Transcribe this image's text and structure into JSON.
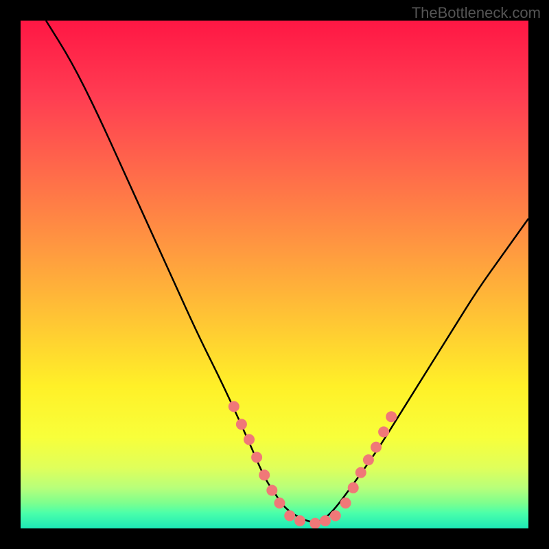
{
  "watermark": "TheBottleneck.com",
  "chart_data": {
    "type": "line",
    "title": "",
    "xlabel": "",
    "ylabel": "",
    "xlim": [
      0,
      100
    ],
    "ylim": [
      0,
      100
    ],
    "curve": {
      "x": [
        5,
        10,
        15,
        20,
        25,
        30,
        35,
        40,
        45,
        48,
        50,
        52,
        55,
        58,
        60,
        62,
        65,
        70,
        75,
        80,
        85,
        90,
        95,
        100
      ],
      "y": [
        100,
        92,
        82,
        71,
        60,
        49,
        38,
        28,
        17,
        10,
        7,
        4,
        2,
        1,
        2,
        4,
        8,
        15,
        23,
        31,
        39,
        47,
        54,
        61
      ]
    },
    "dots": {
      "color": "#f07878",
      "radius": 8,
      "left_cluster": [
        {
          "x": 42,
          "y": 24
        },
        {
          "x": 43.5,
          "y": 20.5
        },
        {
          "x": 45,
          "y": 17.5
        },
        {
          "x": 46.5,
          "y": 14
        },
        {
          "x": 48,
          "y": 10.5
        },
        {
          "x": 49.5,
          "y": 7.5
        },
        {
          "x": 51,
          "y": 5
        }
      ],
      "bottom_cluster": [
        {
          "x": 53,
          "y": 2.5
        },
        {
          "x": 55,
          "y": 1.5
        },
        {
          "x": 58,
          "y": 1
        },
        {
          "x": 60,
          "y": 1.5
        },
        {
          "x": 62,
          "y": 2.5
        }
      ],
      "right_cluster": [
        {
          "x": 64,
          "y": 5
        },
        {
          "x": 65.5,
          "y": 8
        },
        {
          "x": 67,
          "y": 11
        },
        {
          "x": 68.5,
          "y": 13.5
        },
        {
          "x": 70,
          "y": 16
        },
        {
          "x": 71.5,
          "y": 19
        },
        {
          "x": 73,
          "y": 22
        }
      ]
    },
    "gradient_stops": [
      {
        "offset": 0,
        "color": "#ff1744"
      },
      {
        "offset": 0.15,
        "color": "#ff3d52"
      },
      {
        "offset": 0.3,
        "color": "#ff6b4a"
      },
      {
        "offset": 0.45,
        "color": "#ff9940"
      },
      {
        "offset": 0.6,
        "color": "#ffc933"
      },
      {
        "offset": 0.72,
        "color": "#fff028"
      },
      {
        "offset": 0.82,
        "color": "#f8ff3a"
      },
      {
        "offset": 0.88,
        "color": "#e0ff5a"
      },
      {
        "offset": 0.92,
        "color": "#b8ff7a"
      },
      {
        "offset": 0.95,
        "color": "#7dff8e"
      },
      {
        "offset": 0.97,
        "color": "#4affaa"
      },
      {
        "offset": 1.0,
        "color": "#1de9b6"
      }
    ]
  }
}
